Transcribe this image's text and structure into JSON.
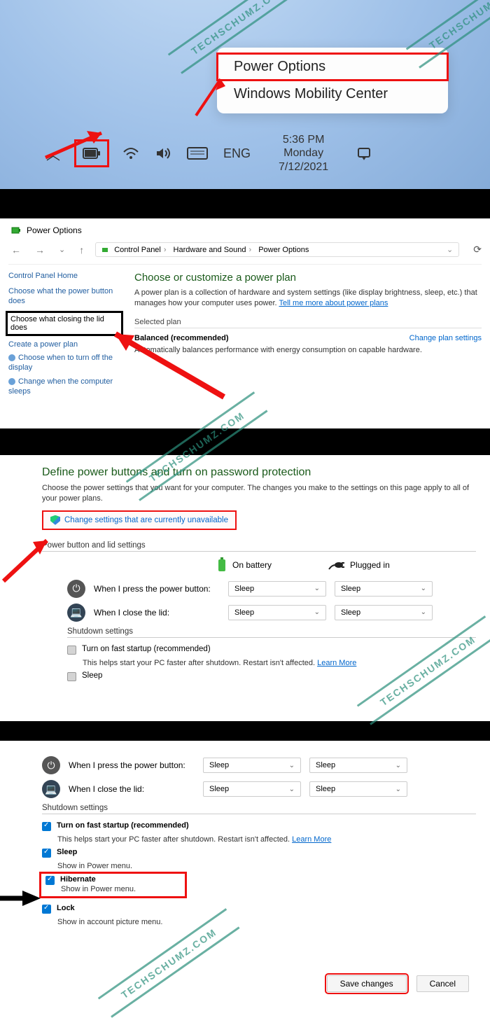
{
  "watermark": "TECHSCHUMZ.COM",
  "panel1": {
    "menu": {
      "power": "Power Options",
      "mobility": "Windows Mobility Center"
    },
    "tray": {
      "lang": "ENG",
      "time": "5:36 PM",
      "day": "Monday",
      "date": "7/12/2021"
    }
  },
  "panel2": {
    "title": "Power Options",
    "crumbs": [
      "Control Panel",
      "Hardware and Sound",
      "Power Options"
    ],
    "home": "Control Panel Home",
    "side": {
      "btn": "Choose what the power button does",
      "lid": "Choose what closing the lid does",
      "create": "Create a power plan",
      "display": "Choose when to turn off the display",
      "sleep": "Change when the computer sleeps"
    },
    "heading": "Choose or customize a power plan",
    "desc": "A power plan is a collection of hardware and system settings (like display brightness, sleep, etc.) that manages how your computer uses power.",
    "tellmore": "Tell me more about power plans",
    "selected": "Selected plan",
    "plan": "Balanced (recommended)",
    "planlink": "Change plan settings",
    "planDesc": "Automatically balances performance with energy consumption on capable hardware."
  },
  "panel3": {
    "heading": "Define power buttons and turn on password protection",
    "desc": "Choose the power settings that you want for your computer. The changes you make to the settings on this page apply to all of your power plans.",
    "changeLink": "Change settings that are currently unavailable",
    "sectLid": "Power button and lid settings",
    "col1": "On battery",
    "col2": "Plugged in",
    "row1": "When I press the power button:",
    "row2": "When I close the lid:",
    "ddval": "Sleep",
    "sectShut": "Shutdown settings",
    "fast": "Turn on fast startup (recommended)",
    "fastSub": "This helps start your PC faster after shutdown. Restart isn't affected.",
    "learn": "Learn More",
    "sleepOpt": "Sleep"
  },
  "panel4": {
    "row1": "When I press the power button:",
    "row2": "When I close the lid:",
    "ddval": "Sleep",
    "sectShut": "Shutdown settings",
    "fast": "Turn on fast startup (recommended)",
    "fastSub": "This helps start your PC faster after shutdown. Restart isn't affected.",
    "learn": "Learn More",
    "sleep": "Sleep",
    "sleepSub": "Show in Power menu.",
    "hibernate": "Hibernate",
    "hibSub": "Show in Power menu.",
    "lock": "Lock",
    "lockSub": "Show in account picture menu.",
    "save": "Save changes",
    "cancel": "Cancel"
  }
}
